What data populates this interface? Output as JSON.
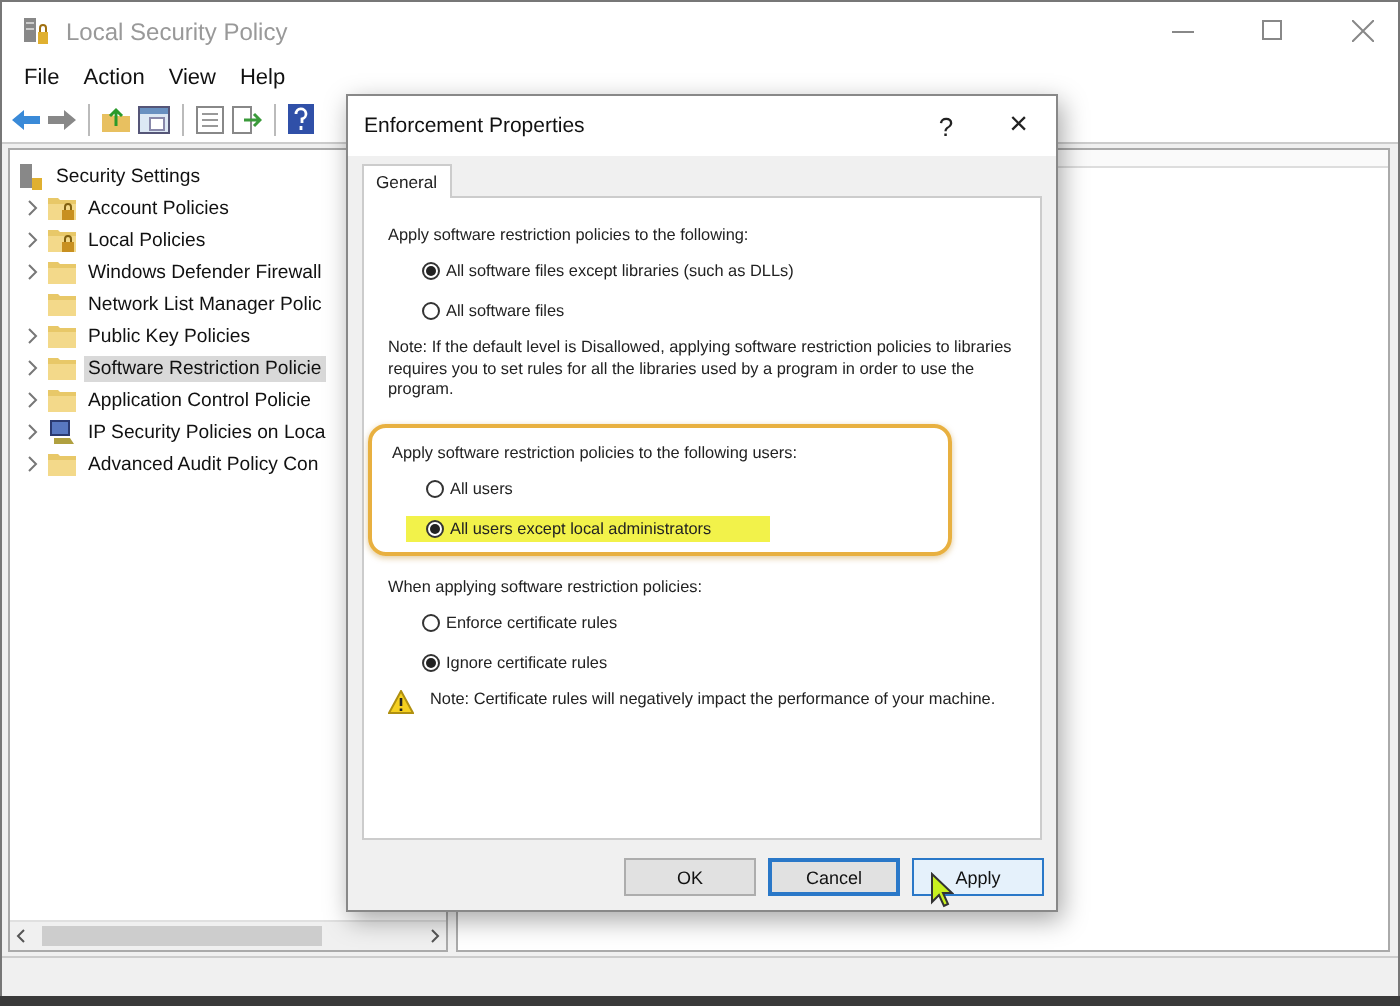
{
  "window": {
    "title": "Local Security Policy"
  },
  "menu": [
    "File",
    "Action",
    "View",
    "Help"
  ],
  "tree": {
    "root": "Security Settings",
    "items": [
      {
        "label": "Account Policies",
        "kind": "folder-lock",
        "expandable": true,
        "selected": false
      },
      {
        "label": "Local Policies",
        "kind": "folder-lock",
        "expandable": true,
        "selected": false
      },
      {
        "label": "Windows Defender Firewall",
        "kind": "folder",
        "expandable": true,
        "selected": false
      },
      {
        "label": "Network List Manager Polic",
        "kind": "folder",
        "expandable": false,
        "selected": false
      },
      {
        "label": "Public Key Policies",
        "kind": "folder",
        "expandable": true,
        "selected": false
      },
      {
        "label": "Software Restriction Policie",
        "kind": "folder",
        "expandable": true,
        "selected": true
      },
      {
        "label": "Application Control Policie",
        "kind": "folder",
        "expandable": true,
        "selected": false
      },
      {
        "label": "IP Security Policies on Loca",
        "kind": "network",
        "expandable": true,
        "selected": false
      },
      {
        "label": "Advanced Audit Policy Con",
        "kind": "folder",
        "expandable": true,
        "selected": false
      }
    ]
  },
  "dialog": {
    "title": "Enforcement Properties",
    "help": "?",
    "close": "×",
    "tabs": [
      {
        "label": "General",
        "selected": true
      }
    ],
    "sections": [
      {
        "heading": "Apply software restriction policies to the following:",
        "highlighted": false,
        "options": [
          {
            "label": "All software files except libraries (such as DLLs)",
            "selected": true,
            "highlighted": false
          },
          {
            "label": "All software files",
            "selected": false,
            "highlighted": false
          }
        ],
        "note": "Note:  If the default level is Disallowed, applying software restriction policies to libraries requires you to set rules for all the libraries used by a program in order to use the program.",
        "warning": false
      },
      {
        "heading": "Apply software restriction policies to the following users:",
        "highlighted": true,
        "options": [
          {
            "label": "All users",
            "selected": false,
            "highlighted": false
          },
          {
            "label": "All users except local administrators",
            "selected": true,
            "highlighted": true
          }
        ]
      },
      {
        "heading": "When applying software restriction policies:",
        "highlighted": false,
        "options": [
          {
            "label": "Enforce certificate rules",
            "selected": false,
            "highlighted": false
          },
          {
            "label": "Ignore certificate rules",
            "selected": true,
            "highlighted": false
          }
        ],
        "note": "Note:  Certificate rules will negatively impact the performance of your machine.",
        "warning": true
      }
    ],
    "buttons": [
      {
        "label": "OK",
        "default": false,
        "hovered": false
      },
      {
        "label": "Cancel",
        "default": true,
        "hovered": false
      },
      {
        "label": "Apply",
        "default": false,
        "hovered": true
      }
    ]
  }
}
